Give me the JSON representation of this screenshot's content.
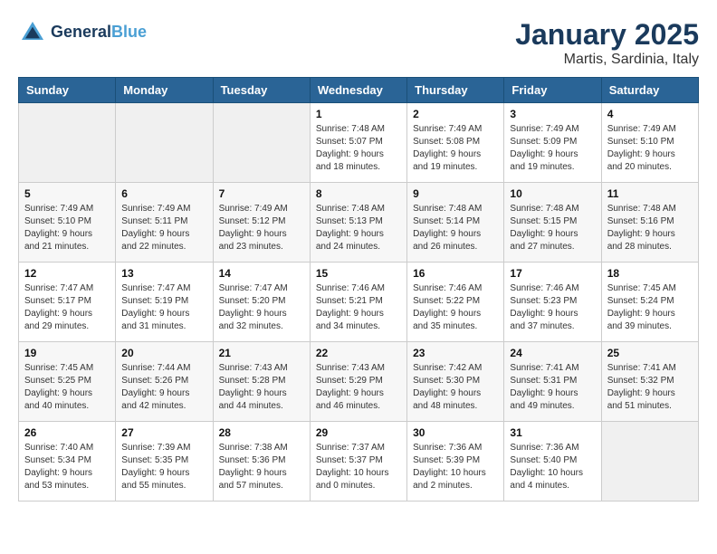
{
  "header": {
    "logo_line1": "General",
    "logo_line2": "Blue",
    "month": "January 2025",
    "location": "Martis, Sardinia, Italy"
  },
  "days_of_week": [
    "Sunday",
    "Monday",
    "Tuesday",
    "Wednesday",
    "Thursday",
    "Friday",
    "Saturday"
  ],
  "weeks": [
    [
      {
        "day": "",
        "content": ""
      },
      {
        "day": "",
        "content": ""
      },
      {
        "day": "",
        "content": ""
      },
      {
        "day": "1",
        "content": "Sunrise: 7:48 AM\nSunset: 5:07 PM\nDaylight: 9 hours\nand 18 minutes."
      },
      {
        "day": "2",
        "content": "Sunrise: 7:49 AM\nSunset: 5:08 PM\nDaylight: 9 hours\nand 19 minutes."
      },
      {
        "day": "3",
        "content": "Sunrise: 7:49 AM\nSunset: 5:09 PM\nDaylight: 9 hours\nand 19 minutes."
      },
      {
        "day": "4",
        "content": "Sunrise: 7:49 AM\nSunset: 5:10 PM\nDaylight: 9 hours\nand 20 minutes."
      }
    ],
    [
      {
        "day": "5",
        "content": "Sunrise: 7:49 AM\nSunset: 5:10 PM\nDaylight: 9 hours\nand 21 minutes."
      },
      {
        "day": "6",
        "content": "Sunrise: 7:49 AM\nSunset: 5:11 PM\nDaylight: 9 hours\nand 22 minutes."
      },
      {
        "day": "7",
        "content": "Sunrise: 7:49 AM\nSunset: 5:12 PM\nDaylight: 9 hours\nand 23 minutes."
      },
      {
        "day": "8",
        "content": "Sunrise: 7:48 AM\nSunset: 5:13 PM\nDaylight: 9 hours\nand 24 minutes."
      },
      {
        "day": "9",
        "content": "Sunrise: 7:48 AM\nSunset: 5:14 PM\nDaylight: 9 hours\nand 26 minutes."
      },
      {
        "day": "10",
        "content": "Sunrise: 7:48 AM\nSunset: 5:15 PM\nDaylight: 9 hours\nand 27 minutes."
      },
      {
        "day": "11",
        "content": "Sunrise: 7:48 AM\nSunset: 5:16 PM\nDaylight: 9 hours\nand 28 minutes."
      }
    ],
    [
      {
        "day": "12",
        "content": "Sunrise: 7:47 AM\nSunset: 5:17 PM\nDaylight: 9 hours\nand 29 minutes."
      },
      {
        "day": "13",
        "content": "Sunrise: 7:47 AM\nSunset: 5:19 PM\nDaylight: 9 hours\nand 31 minutes."
      },
      {
        "day": "14",
        "content": "Sunrise: 7:47 AM\nSunset: 5:20 PM\nDaylight: 9 hours\nand 32 minutes."
      },
      {
        "day": "15",
        "content": "Sunrise: 7:46 AM\nSunset: 5:21 PM\nDaylight: 9 hours\nand 34 minutes."
      },
      {
        "day": "16",
        "content": "Sunrise: 7:46 AM\nSunset: 5:22 PM\nDaylight: 9 hours\nand 35 minutes."
      },
      {
        "day": "17",
        "content": "Sunrise: 7:46 AM\nSunset: 5:23 PM\nDaylight: 9 hours\nand 37 minutes."
      },
      {
        "day": "18",
        "content": "Sunrise: 7:45 AM\nSunset: 5:24 PM\nDaylight: 9 hours\nand 39 minutes."
      }
    ],
    [
      {
        "day": "19",
        "content": "Sunrise: 7:45 AM\nSunset: 5:25 PM\nDaylight: 9 hours\nand 40 minutes."
      },
      {
        "day": "20",
        "content": "Sunrise: 7:44 AM\nSunset: 5:26 PM\nDaylight: 9 hours\nand 42 minutes."
      },
      {
        "day": "21",
        "content": "Sunrise: 7:43 AM\nSunset: 5:28 PM\nDaylight: 9 hours\nand 44 minutes."
      },
      {
        "day": "22",
        "content": "Sunrise: 7:43 AM\nSunset: 5:29 PM\nDaylight: 9 hours\nand 46 minutes."
      },
      {
        "day": "23",
        "content": "Sunrise: 7:42 AM\nSunset: 5:30 PM\nDaylight: 9 hours\nand 48 minutes."
      },
      {
        "day": "24",
        "content": "Sunrise: 7:41 AM\nSunset: 5:31 PM\nDaylight: 9 hours\nand 49 minutes."
      },
      {
        "day": "25",
        "content": "Sunrise: 7:41 AM\nSunset: 5:32 PM\nDaylight: 9 hours\nand 51 minutes."
      }
    ],
    [
      {
        "day": "26",
        "content": "Sunrise: 7:40 AM\nSunset: 5:34 PM\nDaylight: 9 hours\nand 53 minutes."
      },
      {
        "day": "27",
        "content": "Sunrise: 7:39 AM\nSunset: 5:35 PM\nDaylight: 9 hours\nand 55 minutes."
      },
      {
        "day": "28",
        "content": "Sunrise: 7:38 AM\nSunset: 5:36 PM\nDaylight: 9 hours\nand 57 minutes."
      },
      {
        "day": "29",
        "content": "Sunrise: 7:37 AM\nSunset: 5:37 PM\nDaylight: 10 hours\nand 0 minutes."
      },
      {
        "day": "30",
        "content": "Sunrise: 7:36 AM\nSunset: 5:39 PM\nDaylight: 10 hours\nand 2 minutes."
      },
      {
        "day": "31",
        "content": "Sunrise: 7:36 AM\nSunset: 5:40 PM\nDaylight: 10 hours\nand 4 minutes."
      },
      {
        "day": "",
        "content": ""
      }
    ]
  ]
}
